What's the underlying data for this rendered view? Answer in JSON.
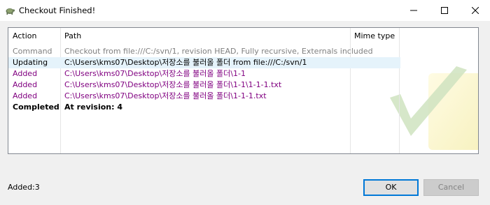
{
  "window": {
    "title": "Checkout Finished!"
  },
  "columns": {
    "action": "Action",
    "path": "Path",
    "mime": "Mime type"
  },
  "rows": [
    {
      "action": "Command",
      "path": "Checkout from file:///C:/svn/1, revision HEAD, Fully recursive, Externals included",
      "color": "#808080",
      "bold": false
    },
    {
      "action": "Updating",
      "path": "C:\\Users\\kms07\\Desktop\\저장소를 불러올 폴더 from file:///C:/svn/1",
      "color": "#000000",
      "bold": false
    },
    {
      "action": "Added",
      "path": "C:\\Users\\kms07\\Desktop\\저장소를 불러올 폴더\\1-1",
      "color": "#800080",
      "bold": false
    },
    {
      "action": "Added",
      "path": "C:\\Users\\kms07\\Desktop\\저장소를 불러올 폴더\\1-1\\1-1-1.txt",
      "color": "#800080",
      "bold": false
    },
    {
      "action": "Added",
      "path": "C:\\Users\\kms07\\Desktop\\저장소를 불러올 폴더\\1-1-1.txt",
      "color": "#800080",
      "bold": false
    },
    {
      "action": "Completed",
      "path": "At revision: 4",
      "color": "#000000",
      "bold": true
    }
  ],
  "status": {
    "summary": "Added:3"
  },
  "buttons": {
    "ok": "OK",
    "cancel": "Cancel"
  },
  "colors": {
    "selection": "#e5f3fb",
    "ok_border": "#0078d7",
    "command_gray": "#808080",
    "added_purple": "#800080"
  },
  "icons": {
    "app": "tortoise-icon",
    "minimize": "minimize-icon",
    "maximize": "maximize-icon",
    "close": "close-icon",
    "watermark": "checkmark-watermark-icon"
  }
}
